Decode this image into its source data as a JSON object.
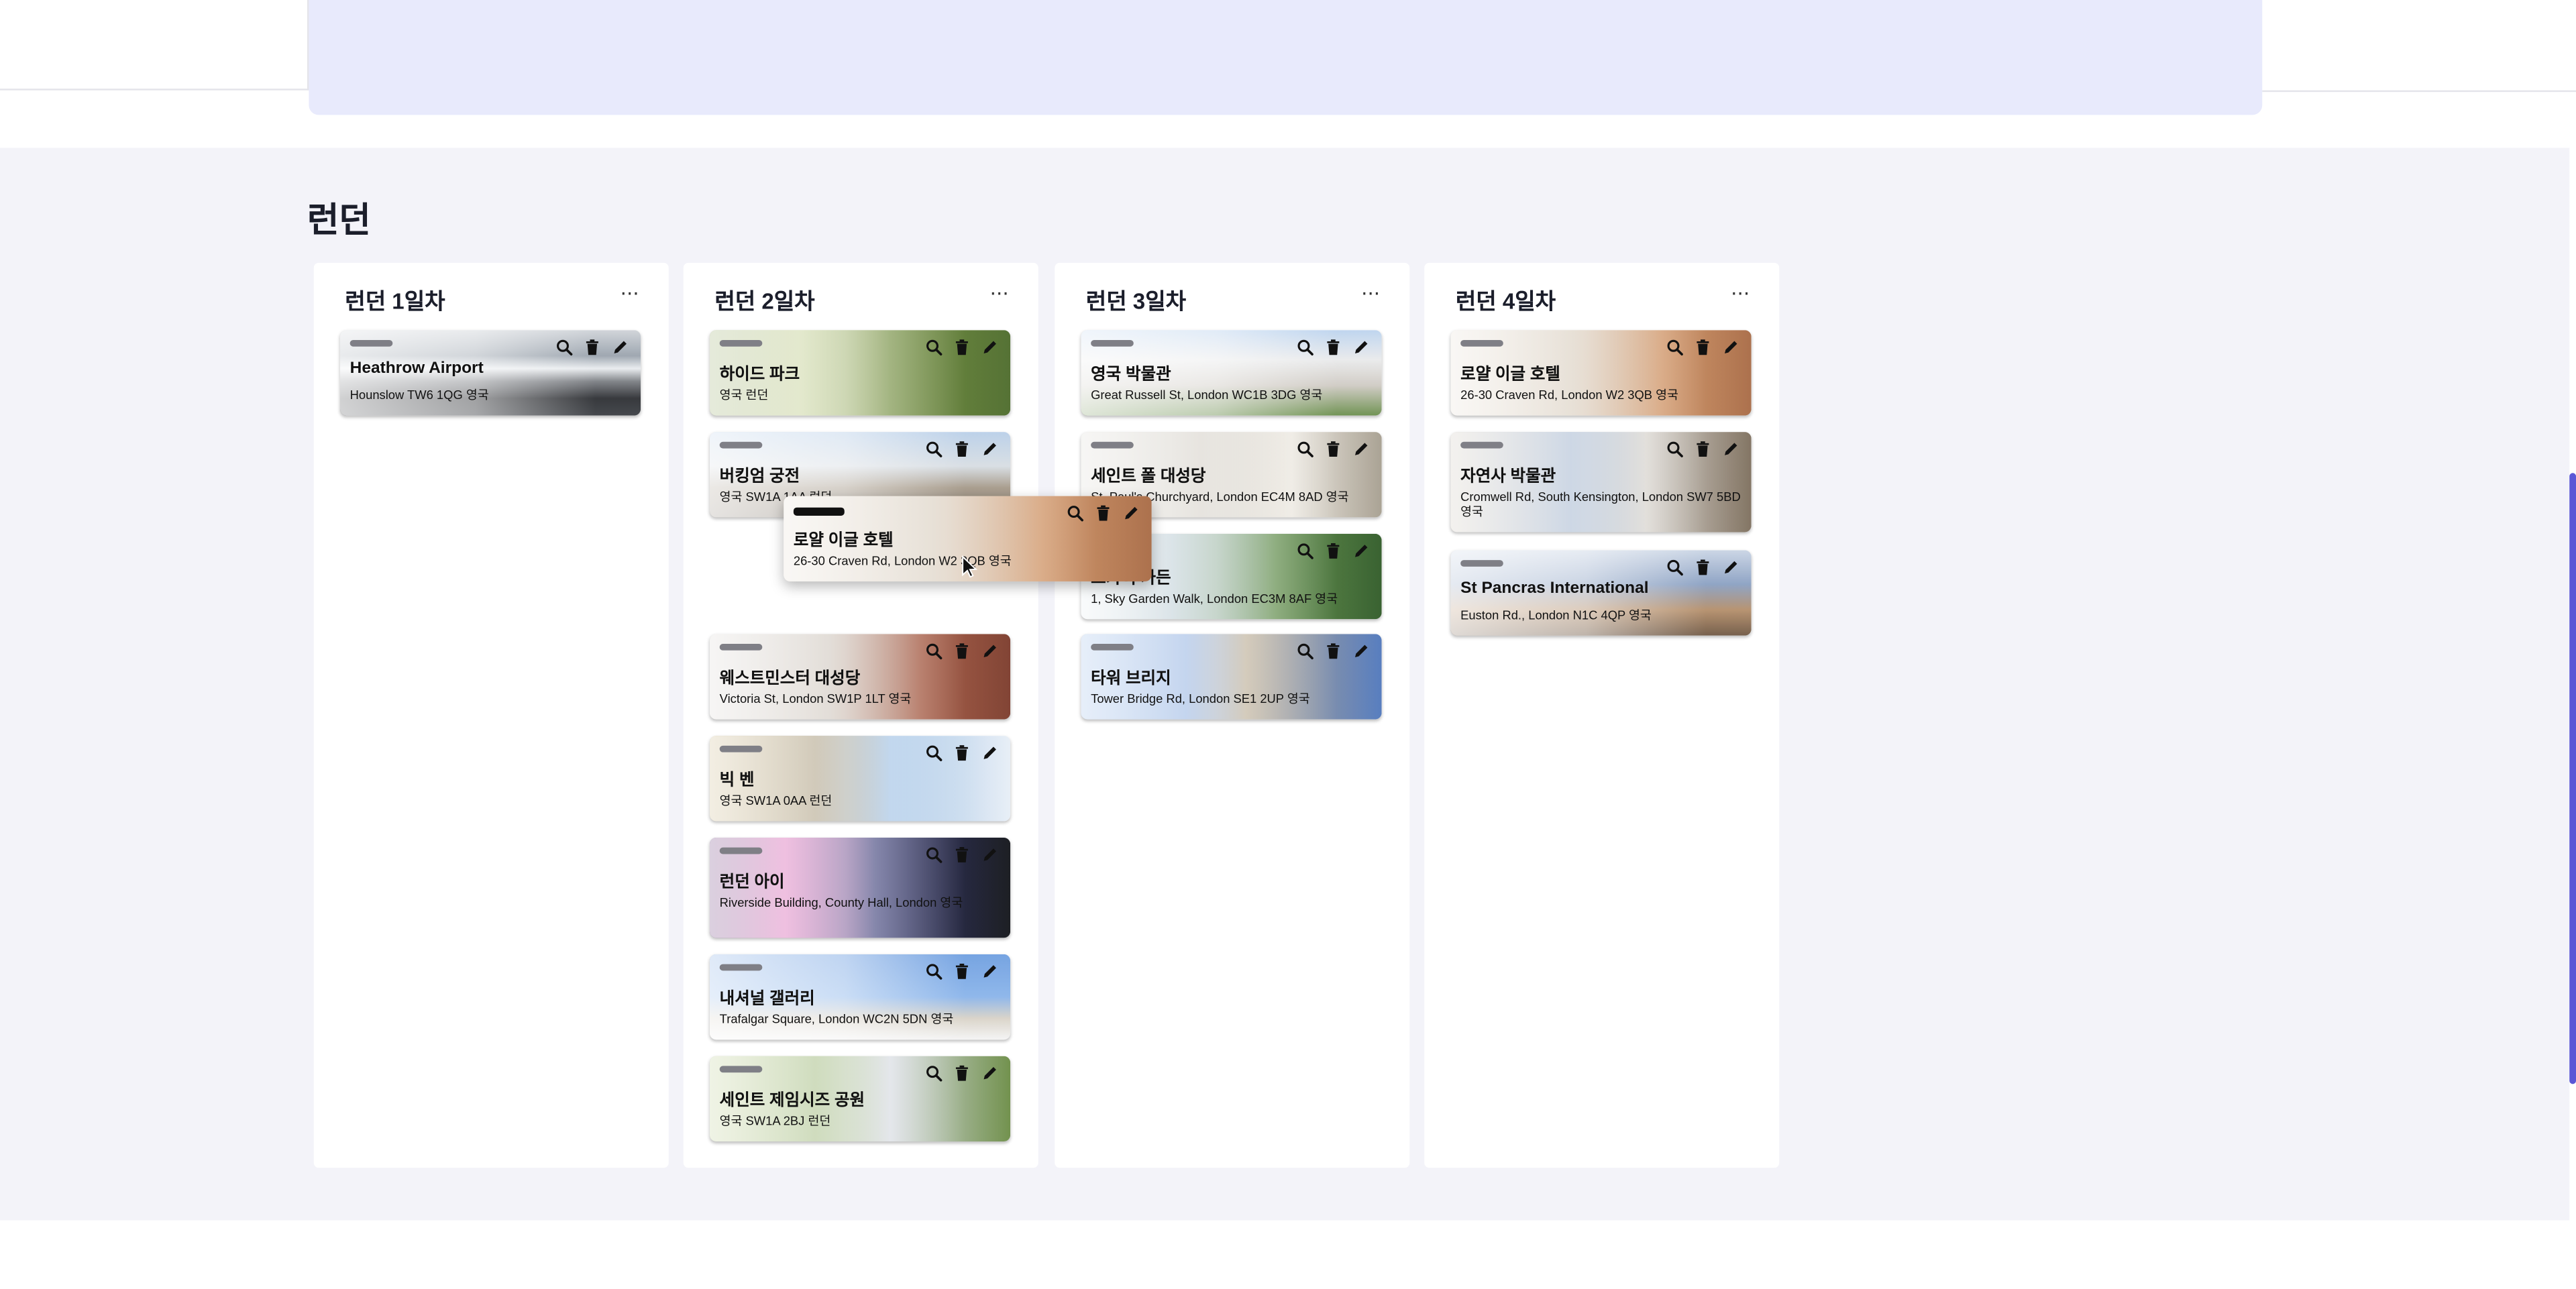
{
  "section": {
    "title": "런던"
  },
  "columns": [
    {
      "title": "런던 1일차",
      "menu": "···",
      "cards": [
        {
          "name": "Heathrow Airport",
          "address": "Hounslow TW6 1QG 영국",
          "image": "airport-terminal"
        }
      ]
    },
    {
      "title": "런던 2일차",
      "menu": "···",
      "cards": [
        {
          "name": "하이드 파크",
          "address": "영국 런던",
          "image": "park-trees"
        },
        {
          "name": "버킹엄 궁전",
          "address": "영국 SW1A 1AA 런던",
          "image": "palace"
        },
        {
          "name": "웨스트민스터 대성당",
          "address": "Victoria St, London SW1P 1LT 영국",
          "image": "cathedral-brick"
        },
        {
          "name": "빅 벤",
          "address": "영국 SW1A 0AA 런던",
          "image": "clock-tower"
        },
        {
          "name": "런던 아이",
          "address": "Riverside Building, County Hall, London 영국",
          "image": "ferris-wheel-night"
        },
        {
          "name": "내셔널 갤러리",
          "address": "Trafalgar Square, London WC2N 5DN 영국",
          "image": "gallery-dome"
        },
        {
          "name": "세인트 제임시즈 공원",
          "address": "영국 SW1A 2BJ 런던",
          "image": "park-lake"
        }
      ]
    },
    {
      "title": "런던 3일차",
      "menu": "···",
      "cards": [
        {
          "name": "영국 박물관",
          "address": "Great Russell St, London WC1B 3DG 영국",
          "image": "museum-columns"
        },
        {
          "name": "세인트 폴 대성당",
          "address": "St. Paul's Churchyard, London EC4M 8AD 영국",
          "image": "dome-cathedral"
        },
        {
          "name": "스카이 가든",
          "address": "1, Sky Garden Walk, London EC3M 8AF 영국",
          "image": "sky-garden"
        },
        {
          "name": "타워 브리지",
          "address": "Tower Bridge Rd, London SE1 2UP 영국",
          "image": "tower-bridge"
        }
      ]
    },
    {
      "title": "런던 4일차",
      "menu": "···",
      "cards": [
        {
          "name": "로얄 이글 호텔",
          "address": "26-30 Craven Rd, London W2 3QB 영국",
          "image": "hotel-street"
        },
        {
          "name": "자연사 박물관",
          "address": "Cromwell Rd, South Kensington, London SW7 5BD 영국",
          "image": "museum-hall"
        },
        {
          "name": "St Pancras International",
          "address": "Euston Rd., London N1C 4QP 영국",
          "image": "station-roof"
        }
      ]
    }
  ],
  "dragging": {
    "name": "로얄 이글 호텔",
    "address": "26-30 Craven Rd, London W2 3QB 영국",
    "image": "hotel-street"
  },
  "icons": {
    "search": "search-icon",
    "delete": "trash-icon",
    "edit": "pencil-icon",
    "menu": "more-horizontal-icon"
  },
  "colors": {
    "banner": "#e8eafc",
    "section_bg": "#f3f3f9",
    "scrollbar": "#5b57d6"
  }
}
